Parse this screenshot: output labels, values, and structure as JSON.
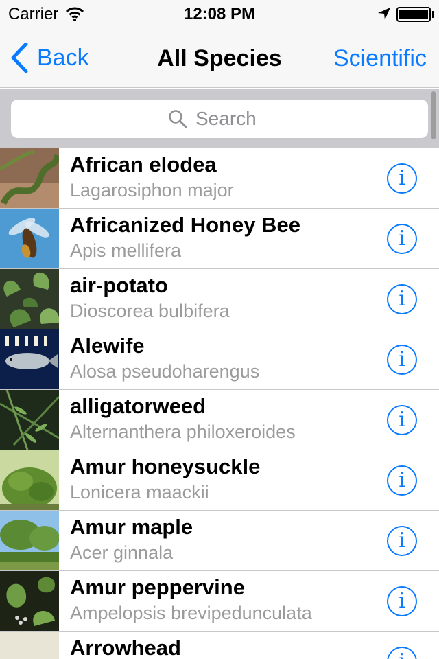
{
  "status_bar": {
    "carrier": "Carrier",
    "time": "12:08 PM",
    "icons": [
      "wifi-icon",
      "location-arrow-icon",
      "battery-icon"
    ]
  },
  "nav": {
    "back_label": "Back",
    "title": "All Species",
    "right_label": "Scientific",
    "accent_color": "#0a7aff"
  },
  "search": {
    "placeholder": "Search",
    "icon": "search-icon"
  },
  "species": [
    {
      "name": "African elodea",
      "scientific": "Lagarosiphon major"
    },
    {
      "name": "Africanized Honey Bee",
      "scientific": "Apis mellifera"
    },
    {
      "name": "air-potato",
      "scientific": "Dioscorea bulbifera"
    },
    {
      "name": "Alewife",
      "scientific": "Alosa pseudoharengus"
    },
    {
      "name": "alligatorweed",
      "scientific": "Alternanthera philoxeroides"
    },
    {
      "name": "Amur honeysuckle",
      "scientific": "Lonicera maackii"
    },
    {
      "name": "Amur maple",
      "scientific": "Acer ginnala"
    },
    {
      "name": "Amur peppervine",
      "scientific": "Ampelopsis brevipedunculata"
    },
    {
      "name": "Arrowhead",
      "scientific": ""
    }
  ],
  "info_icon_label": "i"
}
